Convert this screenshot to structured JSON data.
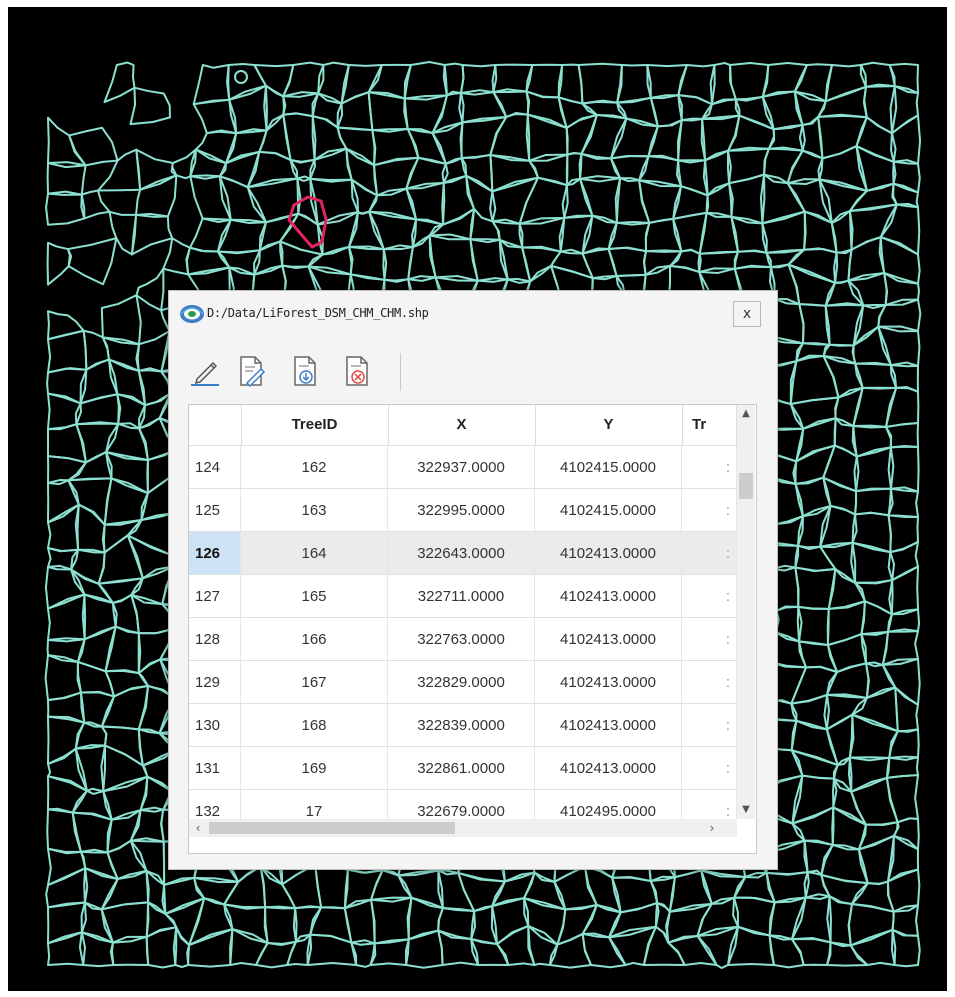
{
  "dialog": {
    "title": "D:/Data/LiForest_DSM_CHM_CHM.shp",
    "close_label": "x"
  },
  "toolbar": {
    "icons": [
      "edit-pencil-icon",
      "edit-document-icon",
      "save-document-icon",
      "delete-document-icon"
    ]
  },
  "table": {
    "columns": [
      "TreeID",
      "X",
      "Y",
      "Tr"
    ],
    "selected_row": "126",
    "rows": [
      {
        "num": "124",
        "treeid": "162",
        "x": "322937.0000",
        "y": "4102415.0000"
      },
      {
        "num": "125",
        "treeid": "163",
        "x": "322995.0000",
        "y": "4102415.0000"
      },
      {
        "num": "126",
        "treeid": "164",
        "x": "322643.0000",
        "y": "4102413.0000"
      },
      {
        "num": "127",
        "treeid": "165",
        "x": "322711.0000",
        "y": "4102413.0000"
      },
      {
        "num": "128",
        "treeid": "166",
        "x": "322763.0000",
        "y": "4102413.0000"
      },
      {
        "num": "129",
        "treeid": "167",
        "x": "322829.0000",
        "y": "4102413.0000"
      },
      {
        "num": "130",
        "treeid": "168",
        "x": "322839.0000",
        "y": "4102413.0000"
      },
      {
        "num": "131",
        "treeid": "169",
        "x": "322861.0000",
        "y": "4102413.0000"
      },
      {
        "num": "132",
        "treeid": "17",
        "x": "322679.0000",
        "y": "4102495.0000"
      }
    ]
  },
  "colors": {
    "polygon_outline": "#8ce0d0",
    "selected_polygon": "#e0245e",
    "map_background": "#000000",
    "selected_row_header": "#cde3f5"
  }
}
